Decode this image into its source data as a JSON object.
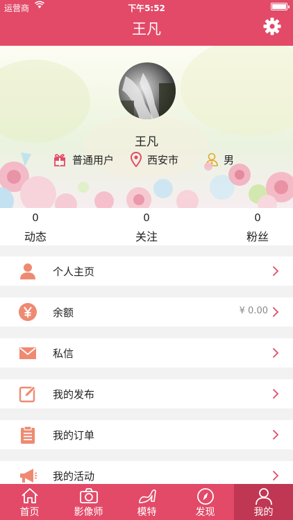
{
  "status_bar": {
    "carrier": "运营商",
    "time": "下午5:52"
  },
  "nav": {
    "title": "王凡",
    "settings_icon": "gear-icon"
  },
  "profile": {
    "name": "王凡",
    "role": "普通用户",
    "city": "西安市",
    "gender": "男"
  },
  "stats": [
    {
      "value": "0",
      "label": "动态"
    },
    {
      "value": "0",
      "label": "关注"
    },
    {
      "value": "0",
      "label": "粉丝"
    }
  ],
  "menu": [
    {
      "label": "个人主页",
      "icon": "person-icon",
      "value": ""
    },
    {
      "label": "余额",
      "icon": "yen-icon",
      "value": "¥ 0.00"
    },
    {
      "label": "私信",
      "icon": "envelope-icon",
      "value": ""
    },
    {
      "label": "我的发布",
      "icon": "edit-icon",
      "value": ""
    },
    {
      "label": "我的订单",
      "icon": "clipboard-icon",
      "value": ""
    },
    {
      "label": "我的活动",
      "icon": "megaphone-icon",
      "value": ""
    }
  ],
  "tabs": [
    {
      "label": "首页",
      "icon": "home-icon"
    },
    {
      "label": "影像师",
      "icon": "camera-icon"
    },
    {
      "label": "模特",
      "icon": "high-heel-icon"
    },
    {
      "label": "发现",
      "icon": "compass-icon"
    },
    {
      "label": "我的",
      "icon": "person-outline-icon",
      "active": true
    }
  ],
  "colors": {
    "brand": "#e24a68",
    "brand_dark": "#c03753",
    "icon_accent": "#ef8a72",
    "chevron": "#e24a68"
  }
}
